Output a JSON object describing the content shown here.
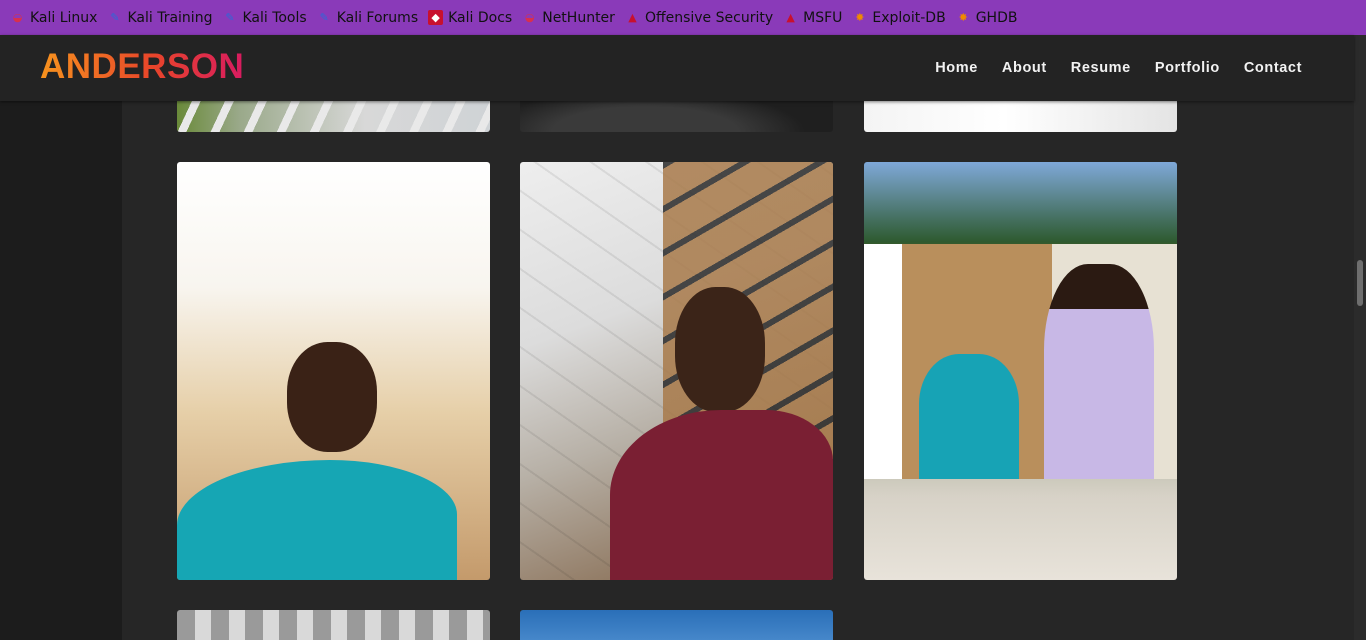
{
  "bookmarks": [
    {
      "label": "Kali Linux",
      "icon": "kali-dragon-icon"
    },
    {
      "label": "Kali Training",
      "icon": "kali-tool-icon"
    },
    {
      "label": "Kali Tools",
      "icon": "kali-tool-icon"
    },
    {
      "label": "Kali Forums",
      "icon": "kali-tool-icon"
    },
    {
      "label": "Kali Docs",
      "icon": "docs-icon"
    },
    {
      "label": "NetHunter",
      "icon": "kali-dragon-icon"
    },
    {
      "label": "Offensive Security",
      "icon": "offsec-icon"
    },
    {
      "label": "MSFU",
      "icon": "offsec-icon"
    },
    {
      "label": "Exploit-DB",
      "icon": "exploit-db-icon"
    },
    {
      "label": "GHDB",
      "icon": "exploit-db-icon"
    }
  ],
  "header": {
    "logo": "ANDERSON",
    "logo_colors": [
      "#f7931e",
      "#e8452a",
      "#d81b60"
    ],
    "nav": [
      "Home",
      "About",
      "Resume",
      "Portfolio",
      "Contact"
    ]
  },
  "colors": {
    "bookmarks_bar": "#8a3ab9",
    "header_bg": "#232323",
    "page_bg": "#1c1c1c",
    "content_bg": "#262626"
  }
}
